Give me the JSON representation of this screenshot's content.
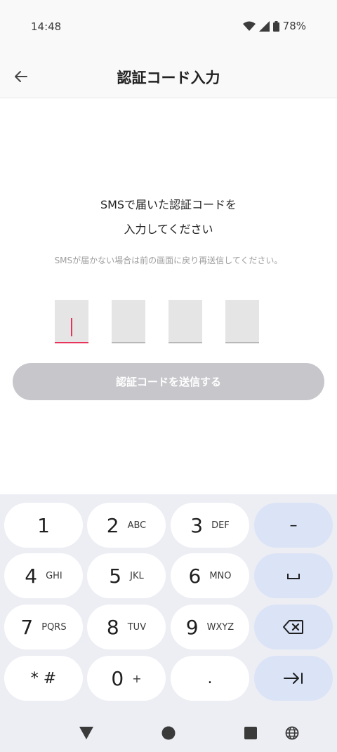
{
  "status_bar": {
    "time": "14:48",
    "battery": "78%"
  },
  "app_bar": {
    "title": "認証コード入力"
  },
  "content": {
    "instruction_line1": "SMSで届いた認証コードを",
    "instruction_line2": "入力してください",
    "hint": "SMSが届かない場合は前の画面に戻り再送信してください。",
    "submit_label": "認証コードを送信する"
  },
  "keyboard": {
    "keys": [
      {
        "main": "1",
        "sub": ""
      },
      {
        "main": "2",
        "sub": "ABC"
      },
      {
        "main": "3",
        "sub": "DEF"
      },
      {
        "main": "–",
        "sub": ""
      },
      {
        "main": "4",
        "sub": "GHI"
      },
      {
        "main": "5",
        "sub": "JKL"
      },
      {
        "main": "6",
        "sub": "MNO"
      },
      {
        "main": "␣",
        "sub": ""
      },
      {
        "main": "7",
        "sub": "PQRS"
      },
      {
        "main": "8",
        "sub": "TUV"
      },
      {
        "main": "9",
        "sub": "WXYZ"
      },
      {
        "main": "* #",
        "sub": ""
      },
      {
        "main": "0",
        "sub": "+"
      },
      {
        "main": ".",
        "sub": ""
      }
    ]
  },
  "colors": {
    "accent": "#e8335b",
    "disabled_button": "#c6c6cb",
    "func_key": "#dbe3f6"
  }
}
